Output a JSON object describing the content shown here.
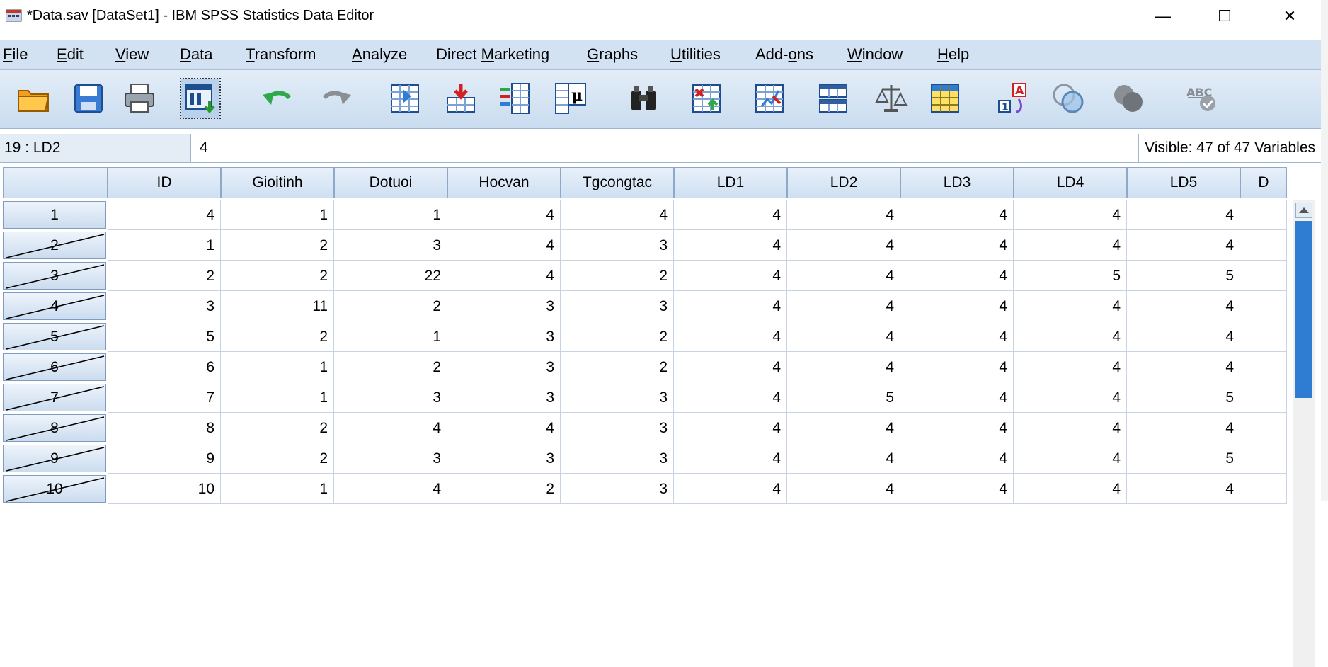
{
  "window": {
    "title": "*Data.sav [DataSet1] - IBM SPSS Statistics Data Editor",
    "minimize": "—",
    "maximize": "☐",
    "close": "✕"
  },
  "menu": [
    {
      "pre": "",
      "ul": "F",
      "post": "ile"
    },
    {
      "pre": "",
      "ul": "E",
      "post": "dit"
    },
    {
      "pre": "",
      "ul": "V",
      "post": "iew"
    },
    {
      "pre": "",
      "ul": "D",
      "post": "ata"
    },
    {
      "pre": "",
      "ul": "T",
      "post": "ransform"
    },
    {
      "pre": "",
      "ul": "A",
      "post": "nalyze"
    },
    {
      "pre": "Direct ",
      "ul": "M",
      "post": "arketing"
    },
    {
      "pre": "",
      "ul": "G",
      "post": "raphs"
    },
    {
      "pre": "",
      "ul": "U",
      "post": "tilities"
    },
    {
      "pre": "Add-",
      "ul": "o",
      "post": "ns"
    },
    {
      "pre": "",
      "ul": "W",
      "post": "indow"
    },
    {
      "pre": "",
      "ul": "H",
      "post": "elp"
    }
  ],
  "toolbar_icons": [
    "open-folder-icon",
    "save-icon",
    "print-icon",
    "recall-dialog-icon",
    "undo-icon",
    "redo-icon",
    "goto-case-icon",
    "goto-variable-icon",
    "variables-icon",
    "descriptives-icon",
    "find-icon",
    "insert-cases-icon",
    "insert-variable-icon",
    "split-file-icon",
    "weight-cases-icon",
    "select-cases-icon",
    "value-labels-icon",
    "use-sets-icon",
    "show-all-variables-icon",
    "spell-check-icon"
  ],
  "editbar": {
    "cell_ref": "19 : LD2",
    "cell_value": "4",
    "visible_vars": "Visible: 47 of 47 Variables"
  },
  "grid": {
    "columns": [
      "ID",
      "Gioitinh",
      "Dotuoi",
      "Hocvan",
      "Tgcongtac",
      "LD1",
      "LD2",
      "LD3",
      "LD4",
      "LD5",
      "D"
    ],
    "rows": [
      {
        "num": "1",
        "filtered": false,
        "cells": [
          "4",
          "1",
          "1",
          "4",
          "4",
          "4",
          "4",
          "4",
          "4",
          "4"
        ]
      },
      {
        "num": "2",
        "filtered": true,
        "cells": [
          "1",
          "2",
          "3",
          "4",
          "3",
          "4",
          "4",
          "4",
          "4",
          "4"
        ]
      },
      {
        "num": "3",
        "filtered": true,
        "cells": [
          "2",
          "2",
          "22",
          "4",
          "2",
          "4",
          "4",
          "4",
          "5",
          "5"
        ]
      },
      {
        "num": "4",
        "filtered": true,
        "cells": [
          "3",
          "11",
          "2",
          "3",
          "3",
          "4",
          "4",
          "4",
          "4",
          "4"
        ]
      },
      {
        "num": "5",
        "filtered": true,
        "cells": [
          "5",
          "2",
          "1",
          "3",
          "2",
          "4",
          "4",
          "4",
          "4",
          "4"
        ]
      },
      {
        "num": "6",
        "filtered": true,
        "cells": [
          "6",
          "1",
          "2",
          "3",
          "2",
          "4",
          "4",
          "4",
          "4",
          "4"
        ]
      },
      {
        "num": "7",
        "filtered": true,
        "cells": [
          "7",
          "1",
          "3",
          "3",
          "3",
          "4",
          "5",
          "4",
          "4",
          "5"
        ]
      },
      {
        "num": "8",
        "filtered": true,
        "cells": [
          "8",
          "2",
          "4",
          "4",
          "3",
          "4",
          "4",
          "4",
          "4",
          "4"
        ]
      },
      {
        "num": "9",
        "filtered": true,
        "cells": [
          "9",
          "2",
          "3",
          "3",
          "3",
          "4",
          "4",
          "4",
          "4",
          "5"
        ]
      },
      {
        "num": "10",
        "filtered": true,
        "cells": [
          "10",
          "1",
          "4",
          "2",
          "3",
          "4",
          "4",
          "4",
          "4",
          "4"
        ]
      }
    ]
  }
}
